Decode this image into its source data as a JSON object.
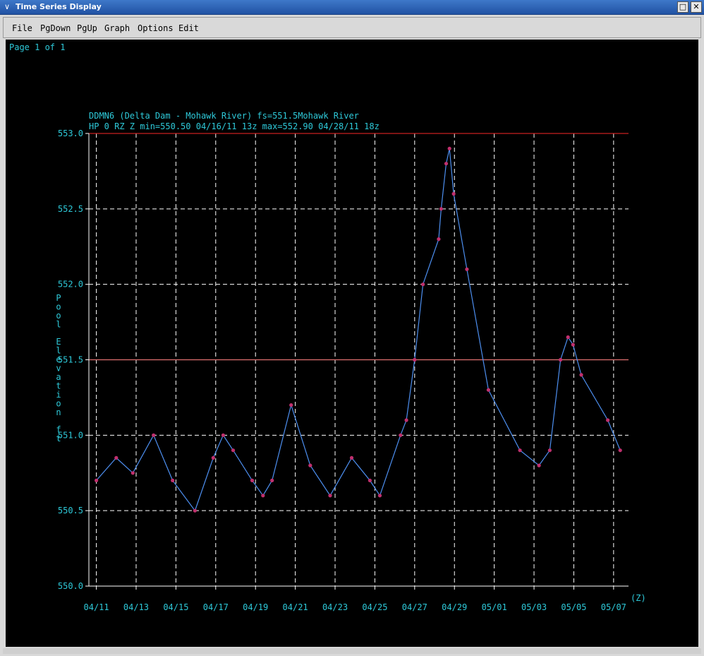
{
  "window": {
    "title": "Time Series Display",
    "menu_glyph": "∨",
    "minimize_glyph": "□",
    "close_glyph": "✕"
  },
  "menu": [
    "File",
    "PgDown",
    "PgUp",
    "Graph",
    "Options",
    "Edit"
  ],
  "page_indicator": "Page 1 of 1",
  "colors": {
    "background": "#000000",
    "text": "#2ec9d9",
    "series_line": "#4d8ff0",
    "point": "#c1306e",
    "grid": "#ffffff",
    "max_line": "#c82020",
    "flood_line": "#e07070"
  },
  "chart_data": {
    "type": "line",
    "title": "DDMN6 (Delta Dam - Mohawk River) fs=551.5Mohawk River",
    "subtitle": "HP 0 RZ Z min=550.50 04/16/11 13z max=552.90 04/28/11 18z",
    "ylabel": "Pool Elevation ft",
    "xlabel": "(Z)",
    "ylim": [
      550.0,
      553.0
    ],
    "xlim": [
      "04/10/11 15z",
      "05/07/11 18z"
    ],
    "y_ticks": [
      "550.0",
      "550.5",
      "551.0",
      "551.5",
      "552.0",
      "552.5",
      "553.0"
    ],
    "x_ticks": [
      "04/11",
      "04/13",
      "04/15",
      "04/17",
      "04/19",
      "04/21",
      "04/23",
      "04/25",
      "04/27",
      "04/29",
      "05/01",
      "05/03",
      "05/05",
      "05/07"
    ],
    "reference_lines": [
      {
        "label": "fs",
        "value": 551.5
      },
      {
        "label": "max",
        "value": 553.0
      }
    ],
    "grid": true,
    "series": [
      {
        "x": [
          "04/11/11 00z",
          "04/12/11 00z",
          "04/12/11 20z",
          "04/13/11 21z",
          "04/14/11 20z",
          "04/15/11 23z",
          "04/16/11 21z",
          "04/17/11 09z",
          "04/17/11 21z",
          "04/18/11 20z",
          "04/19/11 09z",
          "04/19/11 20z",
          "04/20/11 19z",
          "04/21/11 18z",
          "04/22/11 18z",
          "04/23/11 20z",
          "04/24/11 18z",
          "04/25/11 06z",
          "04/26/11 07z",
          "04/26/11 14z",
          "04/27/11 00z",
          "04/27/11 10z",
          "04/28/11 05z",
          "04/28/11 08z",
          "04/28/11 14z",
          "04/28/11 18z",
          "04/28/11 23z",
          "04/29/11 15z",
          "04/30/11 17z",
          "05/02/11 07z",
          "05/03/11 06z",
          "05/03/11 19z",
          "05/04/11 08z",
          "05/04/11 17z",
          "05/04/11 23z",
          "05/05/11 09z",
          "05/06/11 17z",
          "05/07/11 08z"
        ],
        "values": [
          550.7,
          550.85,
          550.75,
          551.0,
          550.7,
          550.5,
          550.85,
          551.0,
          550.9,
          550.7,
          550.6,
          550.7,
          551.2,
          550.8,
          550.6,
          550.85,
          550.7,
          550.6,
          551.0,
          551.1,
          551.5,
          552.0,
          552.3,
          552.5,
          552.8,
          552.9,
          552.6,
          552.1,
          551.3,
          550.9,
          550.8,
          550.9,
          551.5,
          551.65,
          551.6,
          551.4,
          551.1,
          550.9
        ]
      }
    ]
  }
}
